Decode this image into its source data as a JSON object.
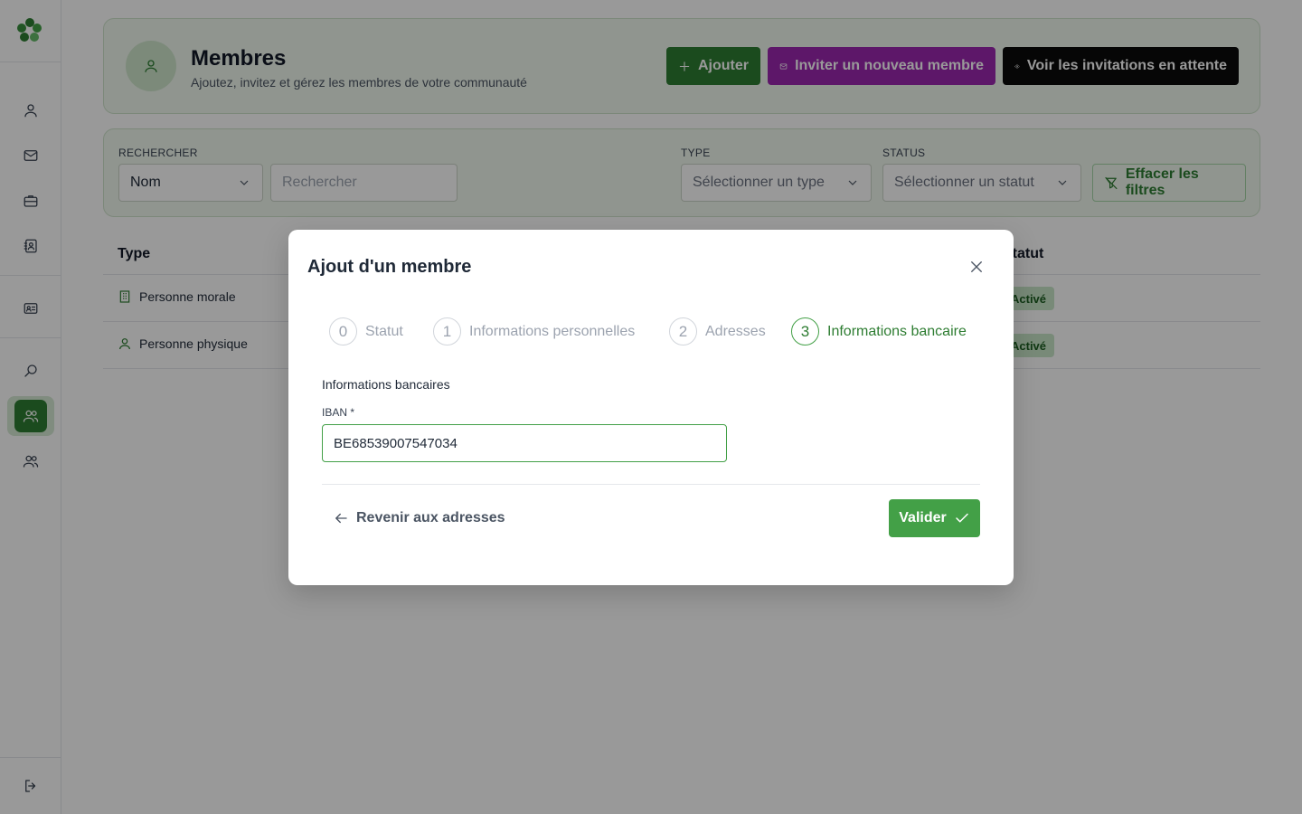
{
  "header": {
    "title": "Membres",
    "subtitle": "Ajoutez, invitez et gérez les membres de votre communauté",
    "add_label": "Ajouter",
    "invite_label": "Inviter un nouveau membre",
    "pending_label": "Voir les invitations en attente"
  },
  "filters": {
    "search_label": "RECHERCHER",
    "search_field_value": "Nom",
    "search_placeholder": "Rechercher",
    "type_label": "TYPE",
    "type_placeholder": "Sélectionner un type",
    "status_label": "STATUS",
    "status_placeholder": "Sélectionner un statut",
    "clear_label": "Effacer les filtres"
  },
  "table": {
    "columns": {
      "type": "Type",
      "status": "Statut"
    },
    "rows": [
      {
        "type": "Personne morale",
        "status": "Activé"
      },
      {
        "type": "Personne physique",
        "status": "Activé"
      }
    ]
  },
  "modal": {
    "title": "Ajout d'un membre",
    "steps": [
      {
        "num": "0",
        "label": "Statut"
      },
      {
        "num": "1",
        "label": "Informations personnelles"
      },
      {
        "num": "2",
        "label": "Adresses"
      },
      {
        "num": "3",
        "label": "Informations bancaire"
      }
    ],
    "current_step": 3,
    "section_title": "Informations bancaires",
    "iban_label": "IBAN *",
    "iban_value": "BE68539007547034",
    "back_label": "Revenir aux adresses",
    "submit_label": "Valider"
  },
  "colors": {
    "primary": "#2e7d32",
    "invite": "#9c27b0",
    "dark": "#0b0b0b"
  }
}
